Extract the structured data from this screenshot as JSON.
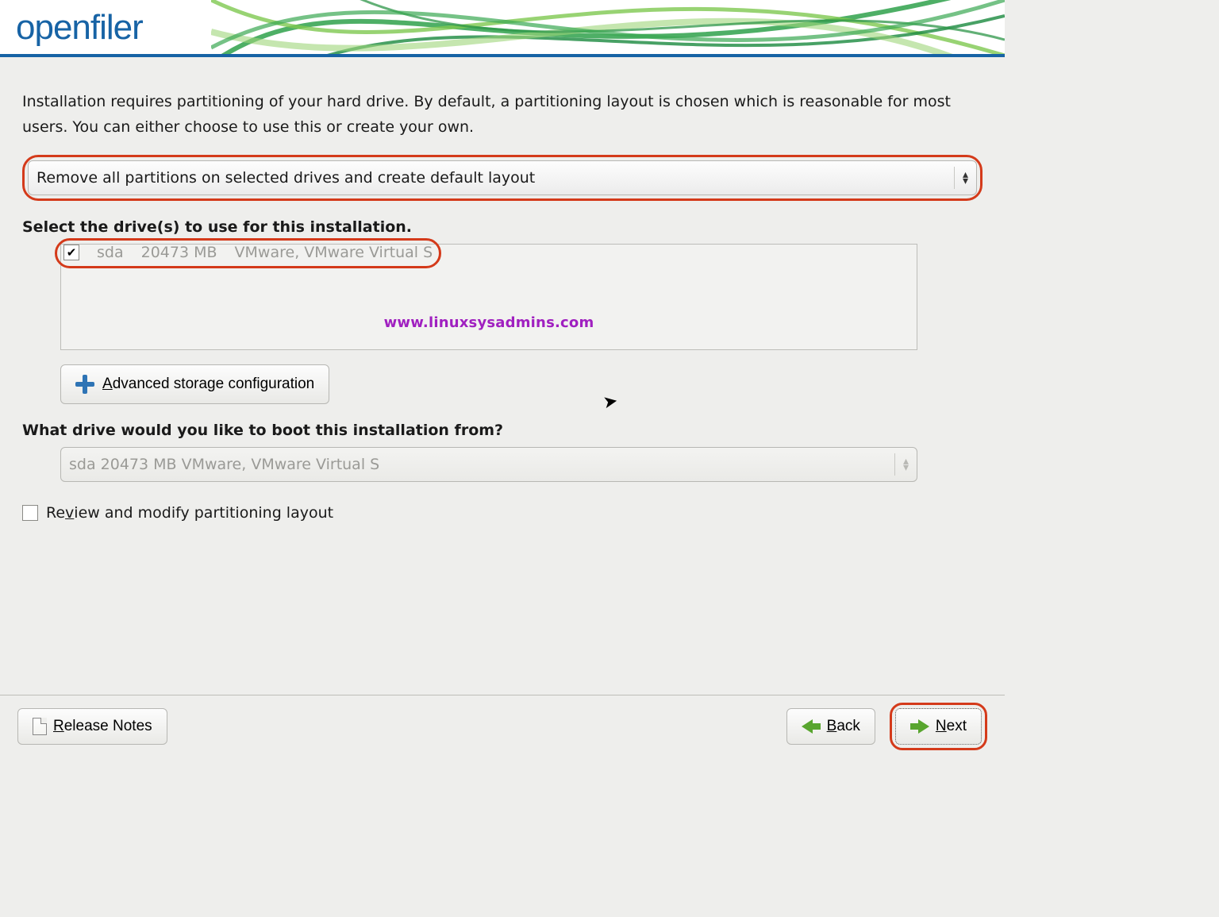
{
  "logo": "openfiler",
  "intro": "Installation requires partitioning of your hard drive.  By default, a partitioning layout is chosen which is reasonable for most users. You can either choose to use this or create your own.",
  "layout_dropdown": {
    "selected": "Remove all partitions on selected drives and create default layout"
  },
  "drives_label": "Select the drive(s) to use for this installation.",
  "drives": [
    {
      "checked": true,
      "name": "sda",
      "size": "20473 MB",
      "model": "VMware, VMware Virtual S"
    }
  ],
  "watermark": "www.linuxsysadmins.com",
  "advanced_btn": {
    "pre": "A",
    "rest": "dvanced storage configuration"
  },
  "boot_label": "What drive would you like to boot this installation from?",
  "boot_dropdown": {
    "selected": "sda    20473 MB VMware, VMware Virtual S"
  },
  "review": {
    "checked": false,
    "pre": "Re",
    "u": "v",
    "post": "iew and modify partitioning layout"
  },
  "footer": {
    "release": {
      "u": "R",
      "rest": "elease Notes"
    },
    "back": {
      "u": "B",
      "rest": "ack"
    },
    "next": {
      "u": "N",
      "rest": "ext"
    }
  }
}
